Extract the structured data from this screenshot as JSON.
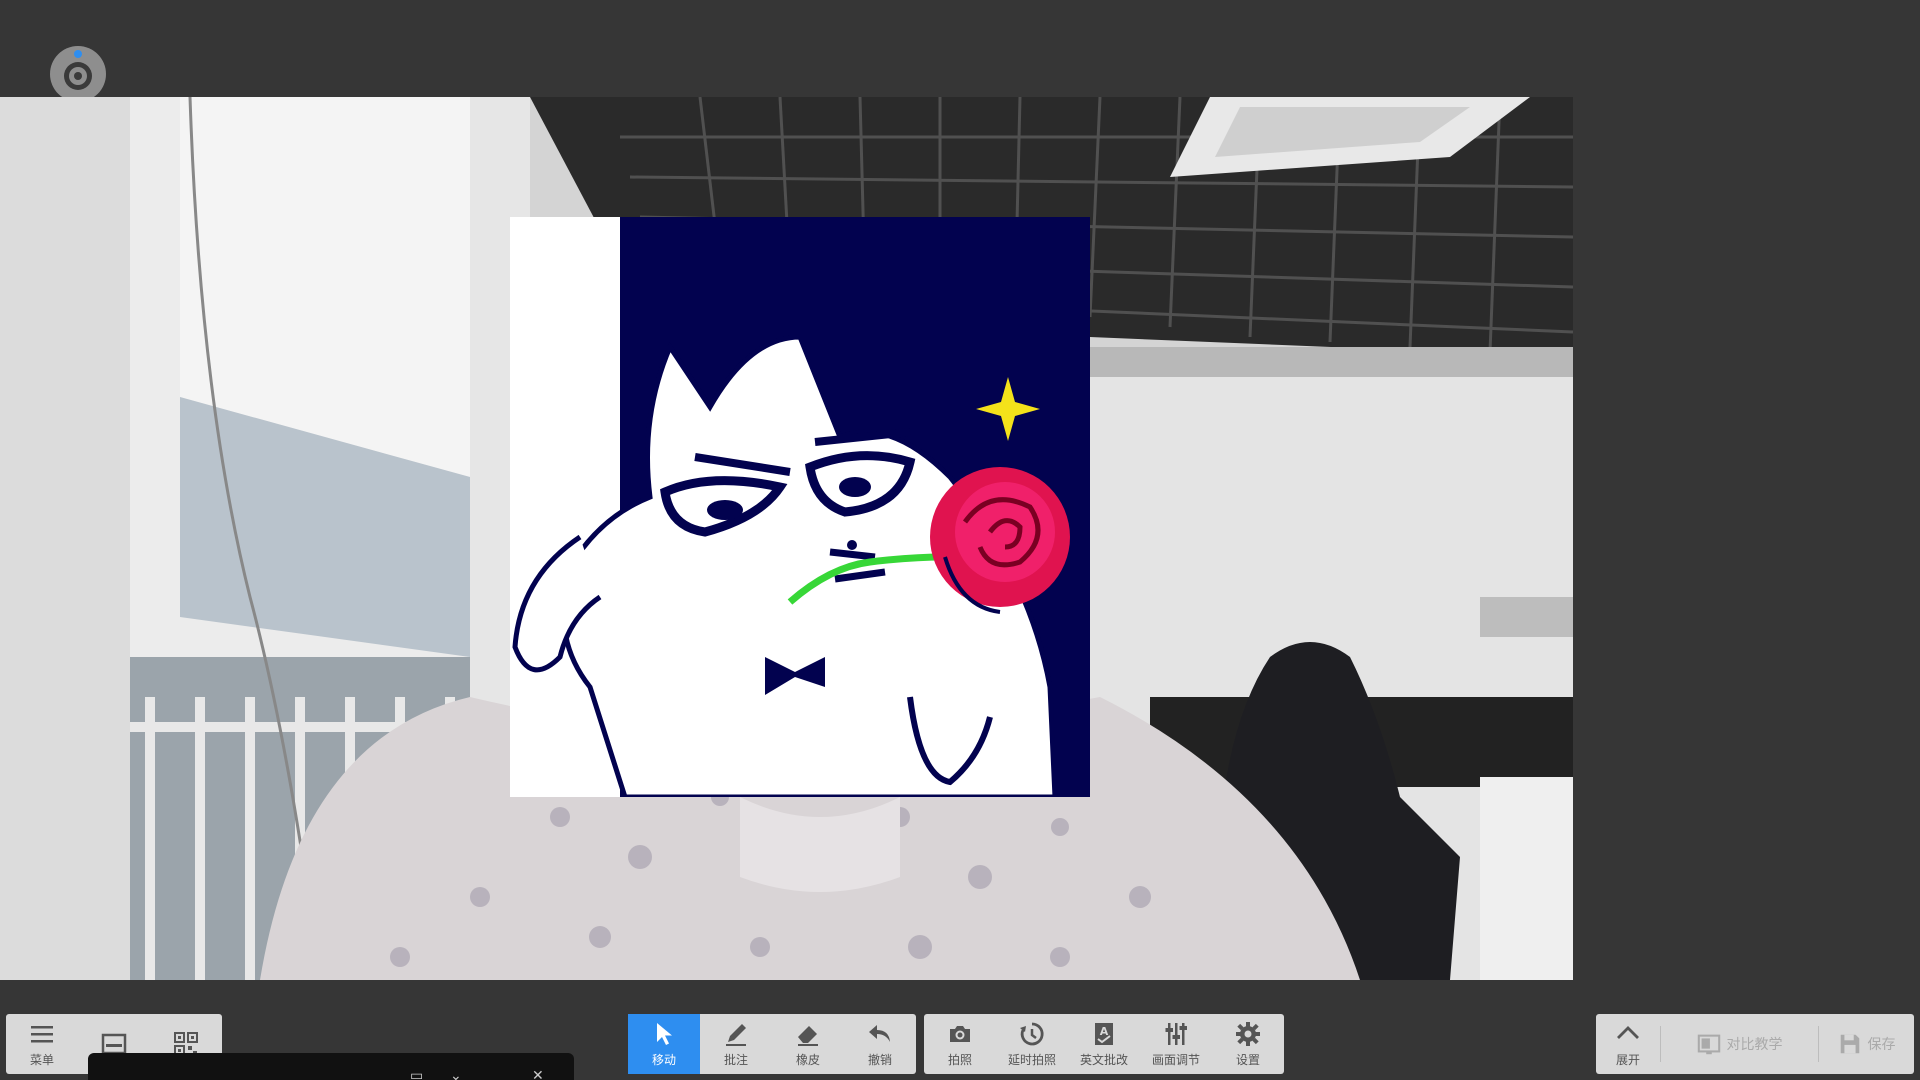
{
  "toolbar_left": {
    "menu_label": "菜单",
    "menu_icon": "hamburger-icon",
    "window_icon": "window-icon",
    "qr_icon": "qr-code-icon"
  },
  "toolbar_annotate": {
    "move_label": "移动",
    "annotate_label": "批注",
    "eraser_label": "橡皮",
    "undo_label": "撤销"
  },
  "toolbar_capture": {
    "photo_label": "拍照",
    "timer_photo_label": "延时拍照",
    "english_label": "英文批改",
    "adjust_label": "画面调节",
    "settings_label": "设置"
  },
  "toolbar_right": {
    "expand_label": "展开",
    "compare_label": "对比教学",
    "save_label": "保存"
  },
  "colors": {
    "background": "#363636",
    "toolbar": "#d9d9d9",
    "active": "#2e8ef0",
    "sticker_bg": "#02024f",
    "rose": "#e0134f",
    "sparkle": "#f4e21a"
  }
}
